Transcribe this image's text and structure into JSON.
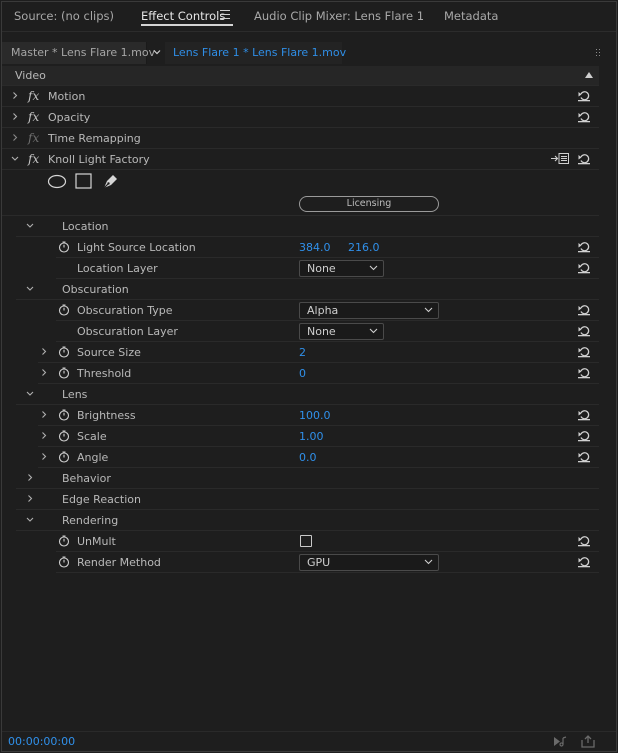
{
  "tabs": [
    {
      "label": "Source: (no clips)"
    },
    {
      "label": "Effect Controls"
    },
    {
      "label": "Audio Clip Mixer: Lens Flare 1"
    },
    {
      "label": "Metadata"
    }
  ],
  "clipbar": {
    "master": "Master * Lens Flare 1.mov",
    "sequence": "Lens Flare 1 * Lens Flare 1.mov"
  },
  "tree": {
    "video_label": "Video",
    "motion": "Motion",
    "opacity": "Opacity",
    "time_remapping": "Time Remapping",
    "effect": "Knoll Light Factory",
    "licensing": "Licensing",
    "location": {
      "group": "Location",
      "light_source_label": "Light Source Location",
      "light_source_x": "384.0",
      "light_source_y": "216.0",
      "layer_label": "Location Layer",
      "layer_value": "None"
    },
    "obscuration": {
      "group": "Obscuration",
      "type_label": "Obscuration Type",
      "type_value": "Alpha",
      "layer_label": "Obscuration Layer",
      "layer_value": "None",
      "source_size_label": "Source Size",
      "source_size_value": "2",
      "threshold_label": "Threshold",
      "threshold_value": "0"
    },
    "lens": {
      "group": "Lens",
      "brightness_label": "Brightness",
      "brightness_value": "100.0",
      "scale_label": "Scale",
      "scale_value": "1.00",
      "angle_label": "Angle",
      "angle_value": "0.0"
    },
    "behavior": "Behavior",
    "edge_reaction": "Edge Reaction",
    "rendering": {
      "group": "Rendering",
      "unmult_label": "UnMult",
      "unmult_checked": false,
      "render_method_label": "Render Method",
      "render_method_value": "GPU"
    }
  },
  "footer": {
    "timecode": "00:00:00:00"
  },
  "colors": {
    "accent_blue": "#3090ea",
    "panel_bg": "#1e1e1e"
  }
}
